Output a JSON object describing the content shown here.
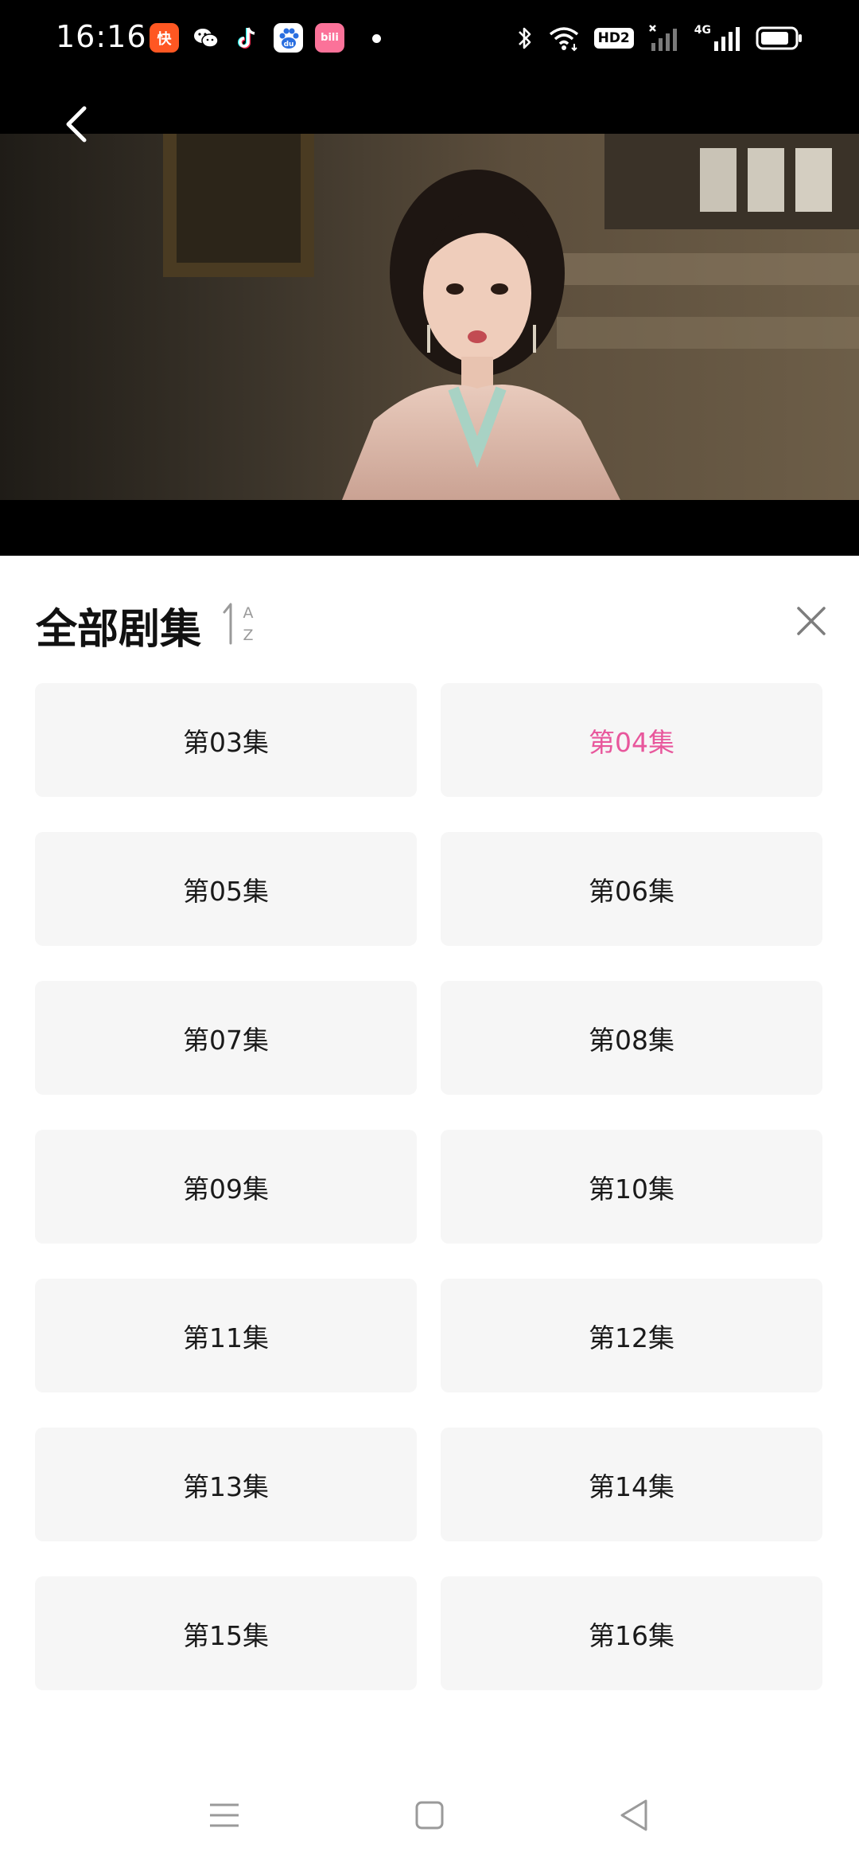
{
  "status_bar": {
    "time": "16:16",
    "notification_icons": [
      {
        "name": "kuaishou-app-icon",
        "glyph": "快",
        "color": "#ff5722"
      },
      {
        "name": "wechat-app-icon",
        "glyph": "微",
        "color": "#000000"
      },
      {
        "name": "douyin-app-icon",
        "glyph": "♪",
        "color": "#000000"
      },
      {
        "name": "baidu-app-icon",
        "glyph": "du",
        "color": "#ffffff"
      },
      {
        "name": "bilibili-app-icon",
        "glyph": "bili",
        "color": "#fb7299"
      }
    ],
    "hd_badge": "HD2",
    "network_label": "4G"
  },
  "panel": {
    "title": "全部剧集",
    "episodes": [
      {
        "label": "第03集",
        "active": false
      },
      {
        "label": "第04集",
        "active": true
      },
      {
        "label": "第05集",
        "active": false
      },
      {
        "label": "第06集",
        "active": false
      },
      {
        "label": "第07集",
        "active": false
      },
      {
        "label": "第08集",
        "active": false
      },
      {
        "label": "第09集",
        "active": false
      },
      {
        "label": "第10集",
        "active": false
      },
      {
        "label": "第11集",
        "active": false
      },
      {
        "label": "第12集",
        "active": false
      },
      {
        "label": "第13集",
        "active": false
      },
      {
        "label": "第14集",
        "active": false
      },
      {
        "label": "第15集",
        "active": false
      },
      {
        "label": "第16集",
        "active": false
      }
    ]
  },
  "colors": {
    "accent": "#e8579c",
    "tile_bg": "#f6f6f6",
    "text": "#1a1a1a"
  },
  "icons": {
    "back": "back-arrow-icon",
    "sort": "sort-az-icon",
    "close": "close-icon",
    "nav_menu": "menu-icon",
    "nav_home": "home-square-icon",
    "nav_back": "back-triangle-icon"
  }
}
